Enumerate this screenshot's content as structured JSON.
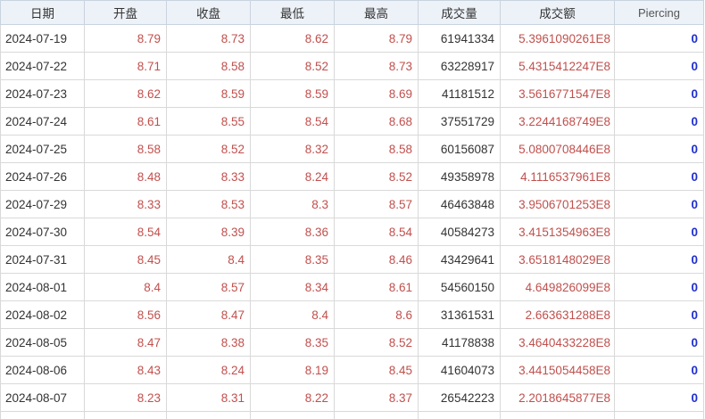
{
  "columns": [
    "日期",
    "开盘",
    "收盘",
    "最低",
    "最高",
    "成交量",
    "成交额",
    "Piercing"
  ],
  "rows": [
    [
      "2024-07-19",
      "8.79",
      "8.73",
      "8.62",
      "8.79",
      "61941334",
      "5.3961090261E8",
      "0"
    ],
    [
      "2024-07-22",
      "8.71",
      "8.58",
      "8.52",
      "8.73",
      "63228917",
      "5.4315412247E8",
      "0"
    ],
    [
      "2024-07-23",
      "8.62",
      "8.59",
      "8.59",
      "8.69",
      "41181512",
      "3.5616771547E8",
      "0"
    ],
    [
      "2024-07-24",
      "8.61",
      "8.55",
      "8.54",
      "8.68",
      "37551729",
      "3.2244168749E8",
      "0"
    ],
    [
      "2024-07-25",
      "8.58",
      "8.52",
      "8.32",
      "8.58",
      "60156087",
      "5.0800708446E8",
      "0"
    ],
    [
      "2024-07-26",
      "8.48",
      "8.33",
      "8.24",
      "8.52",
      "49358978",
      "4.1116537961E8",
      "0"
    ],
    [
      "2024-07-29",
      "8.33",
      "8.53",
      "8.3",
      "8.57",
      "46463848",
      "3.9506701253E8",
      "0"
    ],
    [
      "2024-07-30",
      "8.54",
      "8.39",
      "8.36",
      "8.54",
      "40584273",
      "3.4151354963E8",
      "0"
    ],
    [
      "2024-07-31",
      "8.45",
      "8.4",
      "8.35",
      "8.46",
      "43429641",
      "3.6518148029E8",
      "0"
    ],
    [
      "2024-08-01",
      "8.4",
      "8.57",
      "8.34",
      "8.61",
      "54560150",
      "4.649826099E8",
      "0"
    ],
    [
      "2024-08-02",
      "8.56",
      "8.47",
      "8.4",
      "8.6",
      "31361531",
      "2.663631288E8",
      "0"
    ],
    [
      "2024-08-05",
      "8.47",
      "8.38",
      "8.35",
      "8.52",
      "41178838",
      "3.4640433228E8",
      "0"
    ],
    [
      "2024-08-06",
      "8.43",
      "8.24",
      "8.19",
      "8.45",
      "41604073",
      "3.4415054458E8",
      "0"
    ],
    [
      "2024-08-07",
      "8.23",
      "8.31",
      "8.22",
      "8.37",
      "26542223",
      "2.2018645877E8",
      "0"
    ]
  ],
  "colors": {
    "header_bg": "#edf2f8",
    "price_text": "#c0504d",
    "amount_text": "#c0504d",
    "piercing_text": "#1f2fd0",
    "grid_line": "#d9d9d9"
  }
}
